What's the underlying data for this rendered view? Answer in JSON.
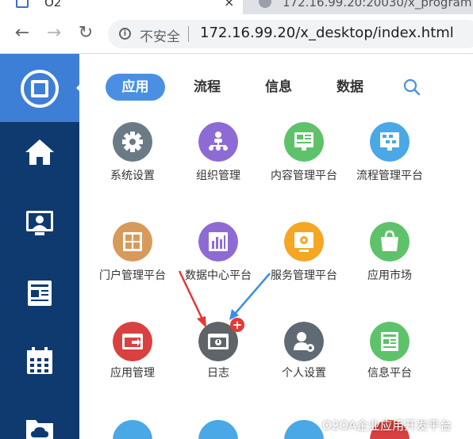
{
  "browser": {
    "tab_active_title": "O2",
    "tab_close": "×",
    "tab_inactive_title": "172.16.99.20:20030/x_program",
    "back_glyph": "←",
    "forward_glyph": "→",
    "reload_glyph": "↻",
    "security_label": "不安全",
    "url": "172.16.99.20/x_desktop/index.html"
  },
  "sidenav": {
    "icons": [
      "logo-icon",
      "home-icon",
      "monitor-user-icon",
      "document-icon",
      "calendar-icon",
      "cloud-folder-icon"
    ]
  },
  "menu": {
    "tabs": [
      "应用",
      "流程",
      "信息",
      "数据"
    ],
    "active_tab": "应用",
    "apps": [
      {
        "label": "系统设置",
        "color": "#6b7b86"
      },
      {
        "label": "组织管理",
        "color": "#8e6bd4"
      },
      {
        "label": "内容管理平台",
        "color": "#5ec26a"
      },
      {
        "label": "流程管理平台",
        "color": "#4aa8e6"
      },
      {
        "label": "门户管理平台",
        "color": "#d89a5a"
      },
      {
        "label": "数据中心平台",
        "color": "#8e6bd4"
      },
      {
        "label": "服务管理平台",
        "color": "#f5a623"
      },
      {
        "label": "应用市场",
        "color": "#5ec26a"
      },
      {
        "label": "应用管理",
        "color": "#d94040"
      },
      {
        "label": "日志",
        "color": "#5f6468"
      },
      {
        "label": "个人设置",
        "color": "#5f6a74"
      },
      {
        "label": "信息平台",
        "color": "#5ec26a"
      }
    ],
    "add_badge": "+"
  },
  "accent": "#4a90e2",
  "watermark": "O2OA企业应用开发平台"
}
